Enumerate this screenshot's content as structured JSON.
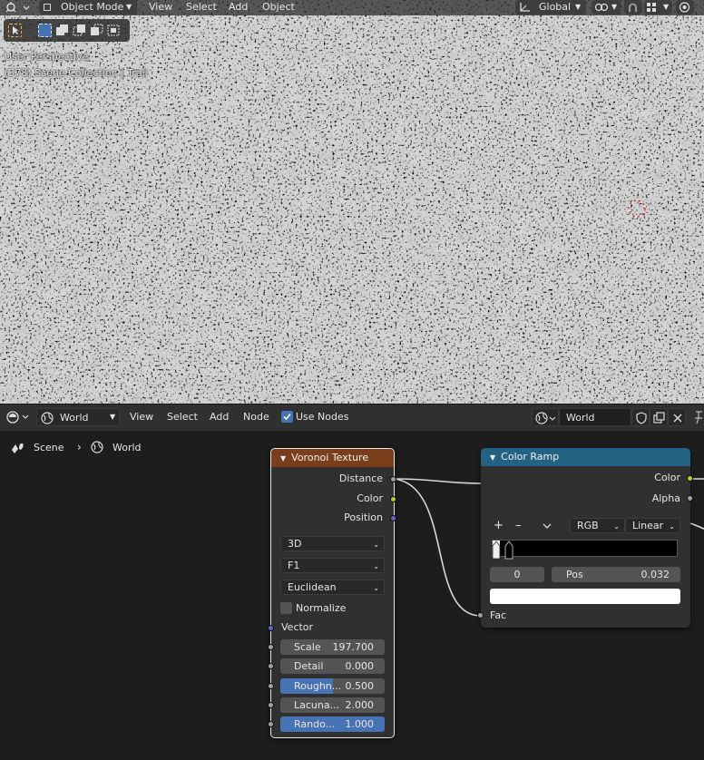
{
  "viewport": {
    "mode": "Object Mode",
    "menus": [
      "View",
      "Select",
      "Add",
      "Object"
    ],
    "orientation": "Global",
    "overlay_line1": "User Perspective",
    "overlay_line2": "(378) Scene Collection | Trail"
  },
  "node_editor": {
    "world_selector": "World",
    "menus": [
      "View",
      "Select",
      "Add",
      "Node"
    ],
    "use_nodes_label": "Use Nodes",
    "use_nodes_checked": true,
    "world_datablock": "World",
    "breadcrumb": {
      "scene": "Scene",
      "world": "World"
    }
  },
  "voronoi": {
    "title": "Voronoi Texture",
    "outputs": [
      "Distance",
      "Color",
      "Position"
    ],
    "dimensions": "3D",
    "feature": "F1",
    "metric": "Euclidean",
    "normalize_label": "Normalize",
    "vector_label": "Vector",
    "fields": [
      {
        "label": "Scale",
        "value": "197.700",
        "fill": 0
      },
      {
        "label": "Detail",
        "value": "0.000",
        "fill": 0
      },
      {
        "label": "Roughn...",
        "value": "0.500",
        "fill": 0.5
      },
      {
        "label": "Lacuna...",
        "value": "2.000",
        "fill": 0
      },
      {
        "label": "Rando...",
        "value": "1.000",
        "fill": 1
      }
    ]
  },
  "color_ramp": {
    "title": "Color Ramp",
    "outputs": [
      "Color",
      "Alpha"
    ],
    "add_glyph": "+",
    "remove_glyph": "–",
    "color_mode": "RGB",
    "interpolation": "Linear",
    "stop_index": "0",
    "pos_label": "Pos",
    "pos_value": "0.032",
    "input_label": "Fac"
  },
  "colors": {
    "voronoi_header": "#7a3e1a",
    "ramp_header": "#246283",
    "accent_blue": "#4772b3",
    "socket_grey": "#a1a1a1",
    "socket_yellow": "#c7c729",
    "socket_purple": "#6363c7"
  }
}
